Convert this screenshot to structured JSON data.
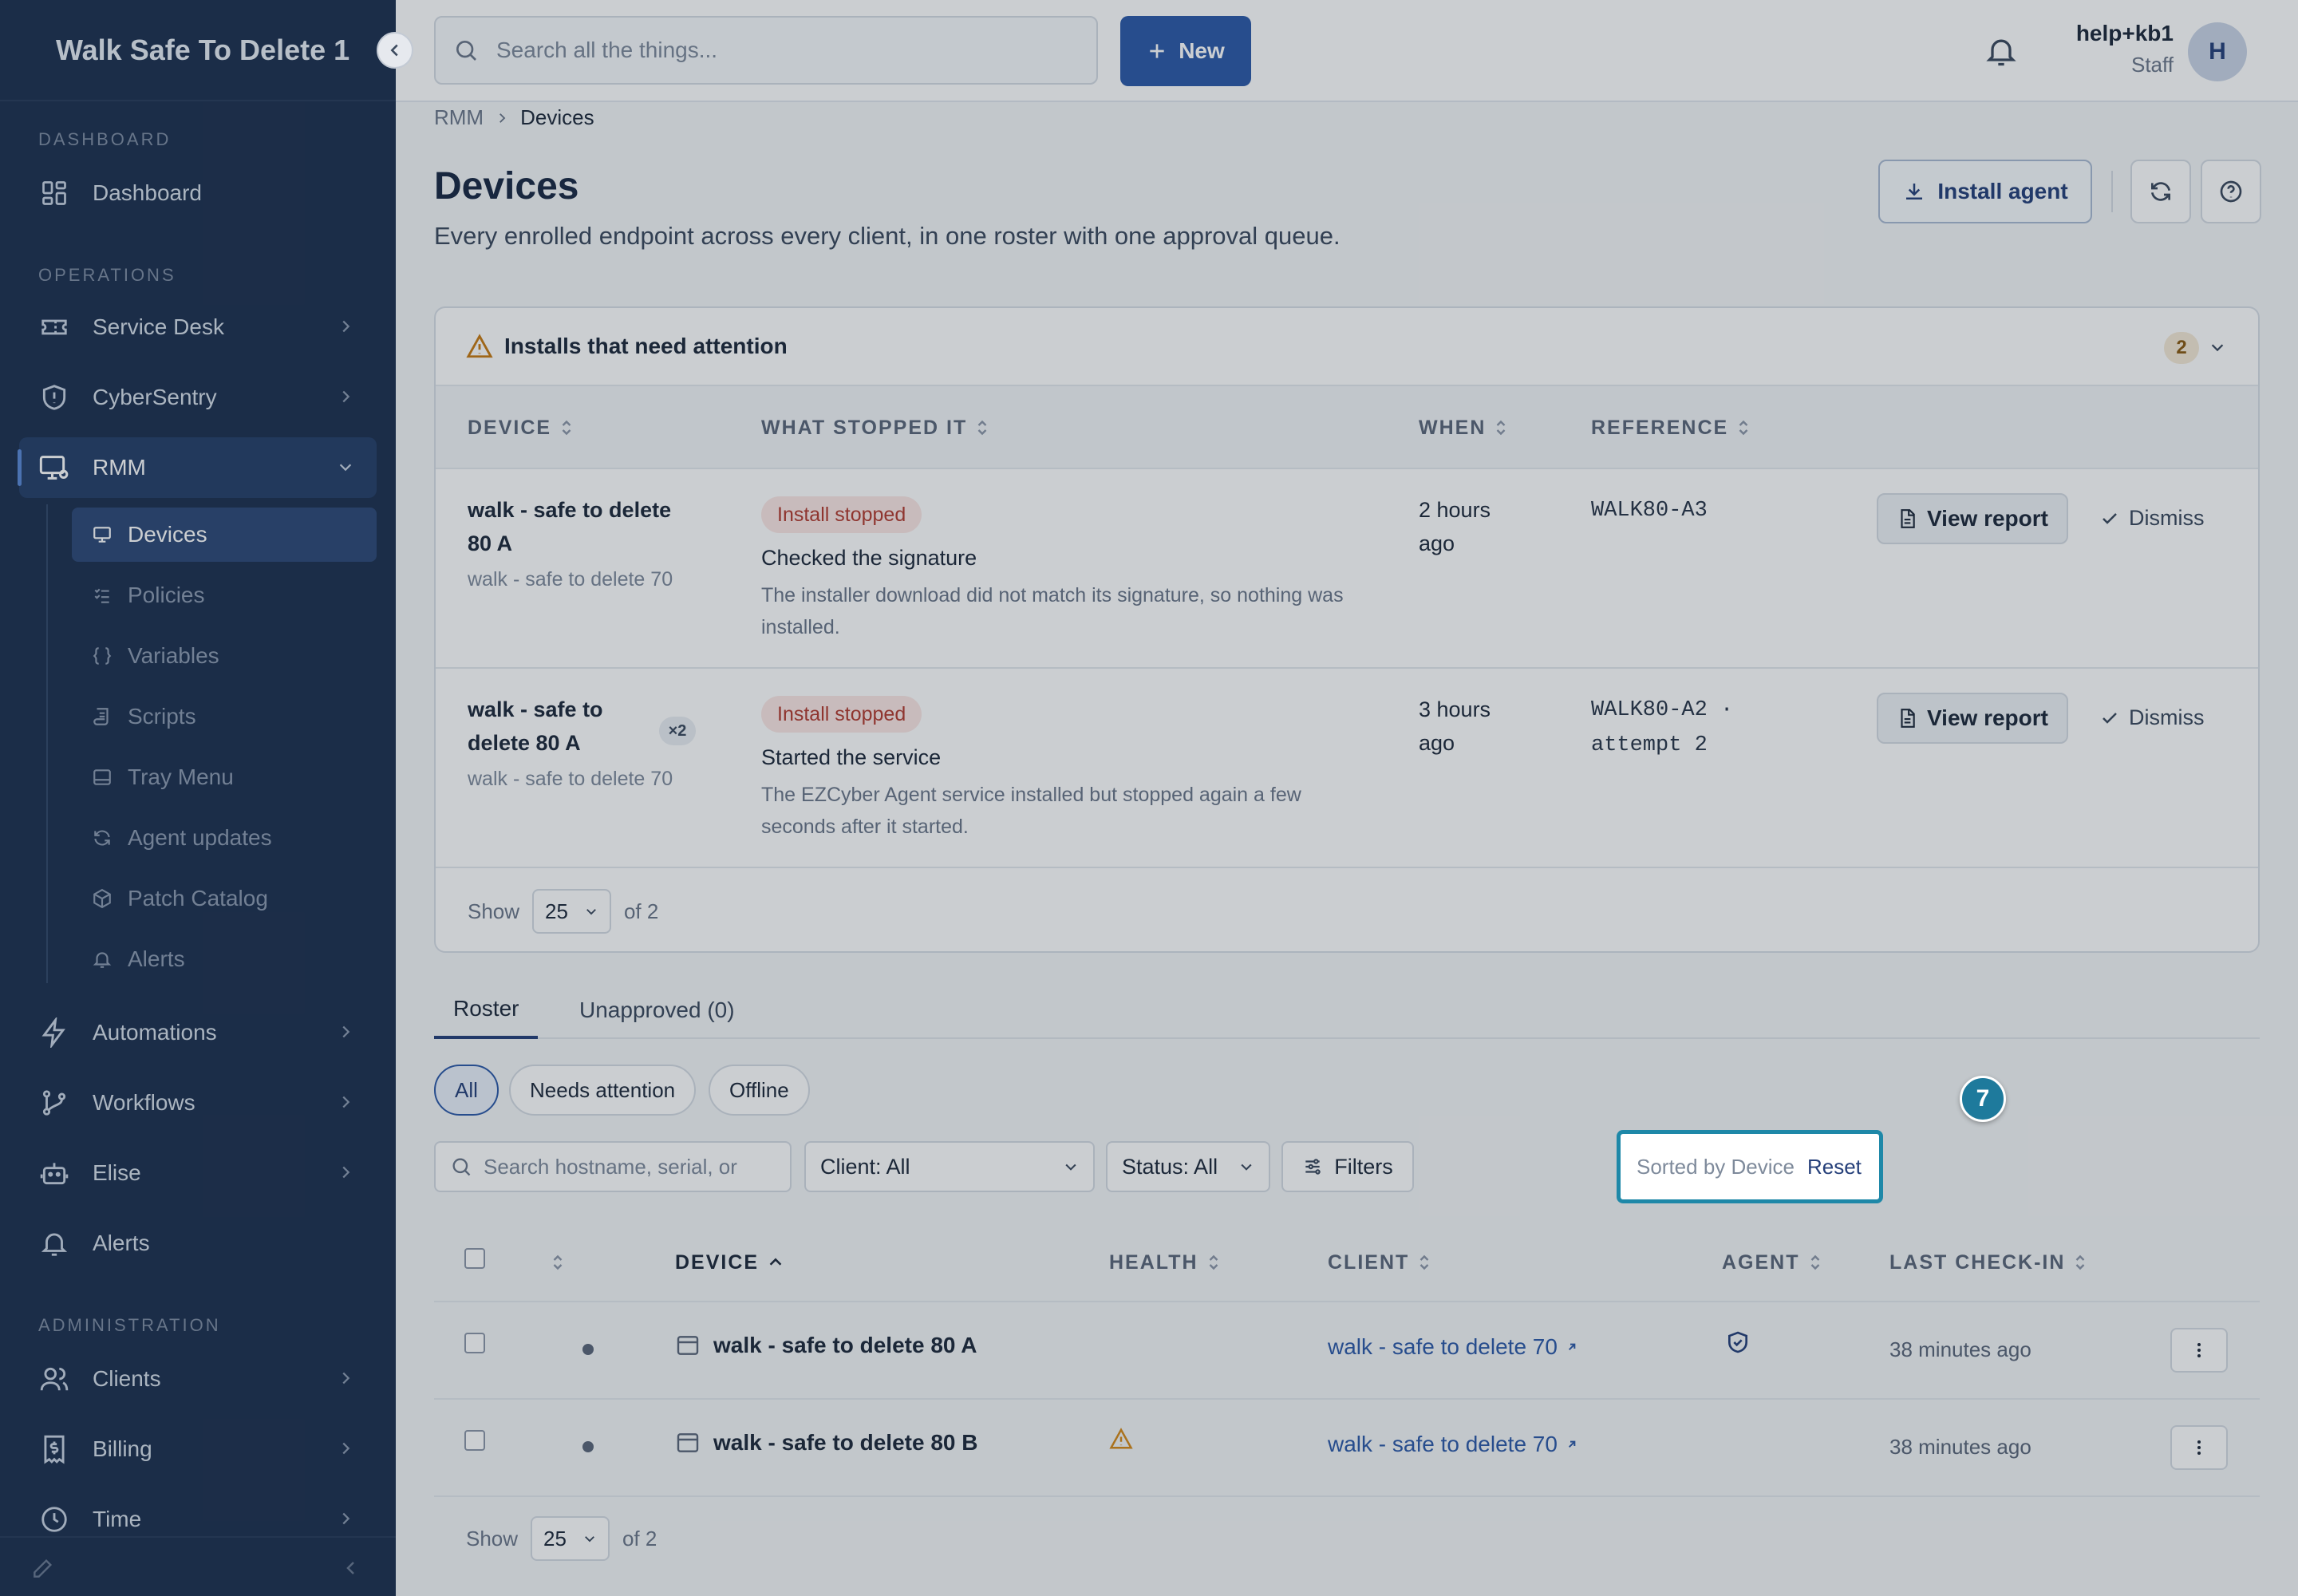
{
  "sidebar": {
    "brand": "Walk Safe To Delete 1",
    "sections": {
      "dashboard": "DASHBOARD",
      "operations": "OPERATIONS",
      "administration": "ADMINISTRATION"
    },
    "items": {
      "dashboard": "Dashboard",
      "service_desk": "Service Desk",
      "cybersentry": "CyberSentry",
      "rmm": "RMM",
      "automations": "Automations",
      "workflows": "Workflows",
      "elise": "Elise",
      "alerts": "Alerts",
      "clients": "Clients",
      "billing": "Billing",
      "time": "Time"
    },
    "rmm_sub": {
      "devices": "Devices",
      "policies": "Policies",
      "variables": "Variables",
      "scripts": "Scripts",
      "tray_menu": "Tray Menu",
      "agent_updates": "Agent updates",
      "patch_catalog": "Patch Catalog",
      "alerts": "Alerts"
    }
  },
  "topbar": {
    "search_placeholder": "Search all the things...",
    "new_label": "New",
    "user_name": "help+kb1",
    "user_role": "Staff",
    "avatar_initial": "H"
  },
  "breadcrumb": {
    "parent": "RMM",
    "current": "Devices"
  },
  "page": {
    "title": "Devices",
    "subtitle": "Every enrolled endpoint across every client, in one roster with one approval queue.",
    "install_agent": "Install agent"
  },
  "attention": {
    "title": "Installs that need attention",
    "count": "2",
    "columns": {
      "device": "DEVICE",
      "what": "WHAT STOPPED IT",
      "when": "WHEN",
      "reference": "REFERENCE"
    },
    "rows": [
      {
        "device_l1": "walk - safe to delete",
        "device_l2": "80 A",
        "client": "walk - safe to delete 70",
        "status": "Install stopped",
        "step": "Checked the signature",
        "desc": "The installer download did not match its signature, so nothing was installed.",
        "when_l1": "2 hours",
        "when_l2": "ago",
        "ref_l1": "WALK80-A3",
        "ref_l2": "",
        "view": "View report",
        "dismiss": "Dismiss"
      },
      {
        "device_l1": "walk - safe to",
        "device_l2": "delete 80 A",
        "multiplier": "×2",
        "client": "walk - safe to delete 70",
        "status": "Install stopped",
        "step": "Started the service",
        "desc": "The EZCyber Agent service installed but stopped again a few seconds after it started.",
        "when_l1": "3 hours",
        "when_l2": "ago",
        "ref_l1": "WALK80-A2 ·",
        "ref_l2": "attempt 2",
        "view": "View report",
        "dismiss": "Dismiss"
      }
    ],
    "show_label": "Show",
    "page_size": "25",
    "of_label": "of 2"
  },
  "tabs": {
    "roster": "Roster",
    "unapproved": "Unapproved (0)"
  },
  "chips": {
    "all": "All",
    "needs_attention": "Needs attention",
    "offline": "Offline"
  },
  "filters": {
    "search_placeholder": "Search hostname, serial, or",
    "client": "Client: All",
    "status": "Status: All",
    "filters_label": "Filters",
    "sorted_by": "Sorted by Device",
    "reset": "Reset",
    "step_badge": "7"
  },
  "roster": {
    "columns": {
      "device": "DEVICE",
      "health": "HEALTH",
      "client": "CLIENT",
      "agent": "AGENT",
      "last_checkin": "LAST CHECK-IN"
    },
    "rows": [
      {
        "device": "walk - safe to delete 80 A",
        "client": "walk - safe to delete 70",
        "last_checkin": "38 minutes ago"
      },
      {
        "device": "walk - safe to delete 80 B",
        "client": "walk - safe to delete 70",
        "last_checkin": "38 minutes ago"
      }
    ],
    "show_label": "Show",
    "page_size": "25",
    "of_label": "of 2"
  }
}
